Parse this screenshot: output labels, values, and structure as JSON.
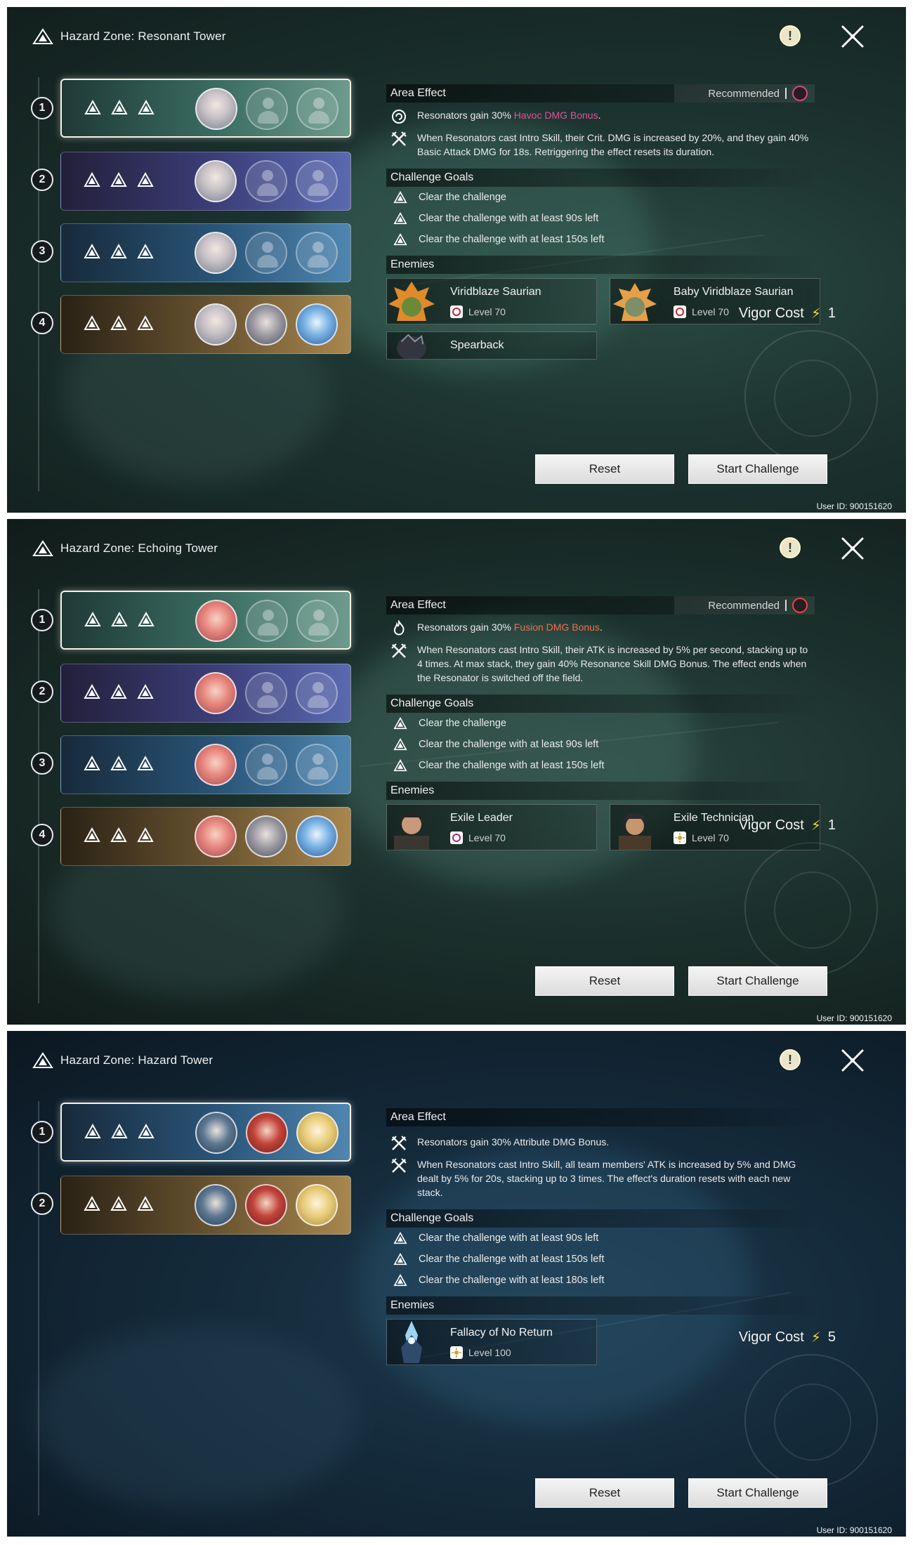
{
  "user_id": "User ID: 900151620",
  "panels": [
    {
      "title": "Hazard Zone: Resonant Tower",
      "area_effect_label": "Area Effect",
      "recommended_label": "Recommended",
      "effect1_pre": "Resonators gain 30% ",
      "effect1_hl": "Havoc DMG Bonus",
      "effect1_post": ".",
      "effect2": "When Resonators cast Intro Skill, their Crit. DMG is increased by 20%, and they gain 40% Basic Attack DMG for 18s. Retriggering the effect resets its duration.",
      "challenge_goals_label": "Challenge Goals",
      "goals": [
        "Clear the challenge",
        "Clear the challenge with at least 90s left",
        "Clear the challenge with at least 150s left"
      ],
      "enemies_label": "Enemies",
      "enemies": [
        {
          "name": "Viridblaze Saurian",
          "level": "Level 70"
        },
        {
          "name": "Baby Viridblaze Saurian",
          "level": "Level 70"
        },
        {
          "name": "Spearback",
          "level": ""
        }
      ],
      "vigor_label": "Vigor Cost",
      "vigor_value": "1",
      "reset_label": "Reset",
      "start_label": "Start Challenge",
      "stages": [
        "1",
        "2",
        "3",
        "4"
      ]
    },
    {
      "title": "Hazard Zone: Echoing Tower",
      "area_effect_label": "Area Effect",
      "recommended_label": "Recommended",
      "effect1_pre": "Resonators gain 30% ",
      "effect1_hl": "Fusion DMG Bonus",
      "effect1_post": ".",
      "effect2": "When Resonators cast Intro Skill, their ATK is increased by 5% per second, stacking up to 4 times. At max stack, they gain 40% Resonance Skill DMG Bonus. The effect ends when the Resonator is switched off the field.",
      "challenge_goals_label": "Challenge Goals",
      "goals": [
        "Clear the challenge",
        "Clear the challenge with at least 90s left",
        "Clear the challenge with at least 150s left"
      ],
      "enemies_label": "Enemies",
      "enemies": [
        {
          "name": "Exile Leader",
          "level": "Level 70"
        },
        {
          "name": "Exile Technician",
          "level": "Level 70"
        }
      ],
      "vigor_label": "Vigor Cost",
      "vigor_value": "1",
      "reset_label": "Reset",
      "start_label": "Start Challenge",
      "stages": [
        "1",
        "2",
        "3",
        "4"
      ]
    },
    {
      "title": "Hazard Zone: Hazard Tower",
      "area_effect_label": "Area Effect",
      "effect1": "Resonators gain 30% Attribute DMG Bonus.",
      "effect2": "When Resonators cast Intro Skill, all team members' ATK is increased by 5% and DMG dealt by 5% for 20s, stacking up to 3 times. The effect's duration resets with each new stack.",
      "challenge_goals_label": "Challenge Goals",
      "goals": [
        "Clear the challenge with at least 90s left",
        "Clear the challenge with at least 150s left",
        "Clear the challenge with at least 180s left"
      ],
      "enemies_label": "Enemies",
      "enemies": [
        {
          "name": "Fallacy of No Return",
          "level": "Level 100"
        }
      ],
      "vigor_label": "Vigor Cost",
      "vigor_value": "5",
      "reset_label": "Reset",
      "start_label": "Start Challenge",
      "stages": [
        "1",
        "2"
      ]
    }
  ],
  "colors": {
    "havoc": "#e0529a",
    "fusion": "#ef6e4d",
    "vigor_bolt": "#f5d74a"
  },
  "icons": [
    "tower-logo-icon",
    "info-icon",
    "close-icon",
    "trial-triangle-icon",
    "havoc-icon",
    "fusion-icon",
    "spectro-icon",
    "lightning-icon"
  ]
}
